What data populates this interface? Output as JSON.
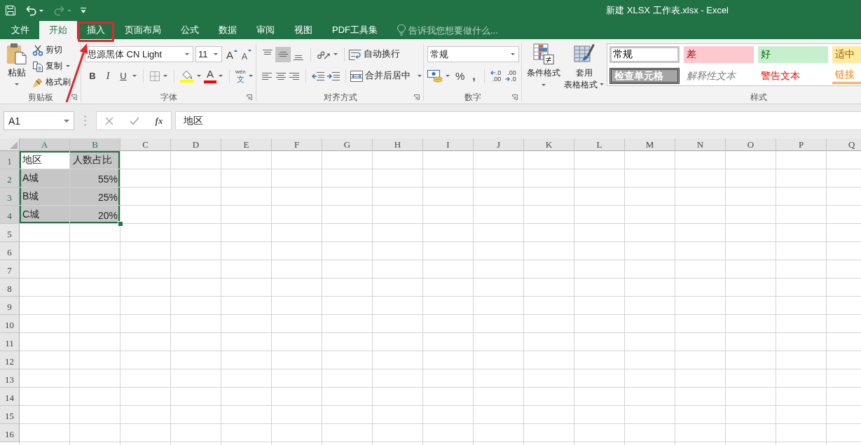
{
  "window": {
    "title": "新建 XLSX 工作表.xlsx - Excel"
  },
  "quick_access": [
    {
      "kind": "save",
      "disabled": false,
      "menu": false
    },
    {
      "kind": "undo",
      "disabled": false,
      "menu": true
    },
    {
      "kind": "redo",
      "disabled": true,
      "menu": true
    },
    {
      "kind": "customize",
      "disabled": false,
      "menu": false
    }
  ],
  "tabs": [
    {
      "label": "文件",
      "selected": false,
      "highlighted": false
    },
    {
      "label": "开始",
      "selected": true,
      "highlighted": false
    },
    {
      "label": "插入",
      "selected": false,
      "highlighted": true
    },
    {
      "label": "页面布局",
      "selected": false,
      "highlighted": false
    },
    {
      "label": "公式",
      "selected": false,
      "highlighted": false
    },
    {
      "label": "数据",
      "selected": false,
      "highlighted": false
    },
    {
      "label": "审阅",
      "selected": false,
      "highlighted": false
    },
    {
      "label": "视图",
      "selected": false,
      "highlighted": false
    },
    {
      "label": "PDF工具集",
      "selected": false,
      "highlighted": false
    }
  ],
  "tell_me": {
    "placeholder": "告诉我您想要做什么..."
  },
  "ribbon": {
    "clipboard": {
      "label": "剪贴板",
      "paste": "粘贴",
      "commands": [
        {
          "kind": "cut",
          "label": "剪切",
          "menu": false
        },
        {
          "kind": "copy",
          "label": "复制",
          "menu": true
        },
        {
          "kind": "format-painter",
          "label": "格式刷",
          "menu": false
        }
      ]
    },
    "font": {
      "label": "字体",
      "font_name": "思源黑体 CN Light",
      "font_size": "11",
      "grow": "A",
      "shrink": "A",
      "styles": [
        {
          "kind": "bold",
          "label": "B",
          "menu": false
        },
        {
          "kind": "italic",
          "label": "I",
          "menu": false
        },
        {
          "kind": "underline",
          "label": "U",
          "menu": true
        }
      ],
      "font_color": "A",
      "phonetic": {
        "ruby": "wén",
        "base": "文"
      }
    },
    "alignment": {
      "label": "对齐方式",
      "vertical": [
        {
          "kind": "top",
          "selected": false
        },
        {
          "kind": "middle",
          "selected": true
        },
        {
          "kind": "bottom",
          "selected": false
        }
      ],
      "horizontal": [
        {
          "kind": "left",
          "selected": false
        },
        {
          "kind": "center",
          "selected": false
        },
        {
          "kind": "right",
          "selected": false
        }
      ],
      "wrap_text": "自动换行",
      "merge": "合并后居中"
    },
    "number": {
      "label": "数字",
      "format": "常规",
      "percent": "%",
      "comma": ",",
      "decimals": [
        {
          "kind": "increase",
          "top": ".0",
          "bottom": ".00"
        },
        {
          "kind": "decrease",
          "top": ".00",
          "bottom": ".0"
        }
      ]
    },
    "styles": {
      "label": "样式",
      "conditional": "条件格式",
      "table_format": [
        "套用",
        "表格格式"
      ],
      "cell_styles": [
        {
          "kind": "normal",
          "label": "常规",
          "selected": true
        },
        {
          "kind": "bad",
          "label": "差",
          "selected": false
        },
        {
          "kind": "good",
          "label": "好",
          "selected": false
        },
        {
          "kind": "neutral",
          "label": "适中",
          "selected": false
        },
        {
          "kind": "check",
          "label": "检查单元格",
          "selected": false
        },
        {
          "kind": "explanatory",
          "label": "解释性文本",
          "selected": false
        },
        {
          "kind": "warning",
          "label": "警告文本",
          "selected": false
        },
        {
          "kind": "linked",
          "label": "链接",
          "selected": false
        }
      ]
    }
  },
  "formula_bar": {
    "name_box": "A1",
    "function_label": "fx",
    "formula": "地区"
  },
  "sheet": {
    "columns": [
      {
        "label": "A",
        "selected": true
      },
      {
        "label": "B",
        "selected": true
      },
      {
        "label": "C",
        "selected": false
      },
      {
        "label": "D",
        "selected": false
      },
      {
        "label": "E",
        "selected": false
      },
      {
        "label": "F",
        "selected": false
      },
      {
        "label": "G",
        "selected": false
      },
      {
        "label": "H",
        "selected": false
      },
      {
        "label": "I",
        "selected": false
      },
      {
        "label": "J",
        "selected": false
      },
      {
        "label": "K",
        "selected": false
      },
      {
        "label": "L",
        "selected": false
      },
      {
        "label": "M",
        "selected": false
      },
      {
        "label": "N",
        "selected": false
      },
      {
        "label": "O",
        "selected": false
      },
      {
        "label": "P",
        "selected": false
      },
      {
        "label": "Q",
        "selected": false
      }
    ],
    "rows": [
      {
        "label": "1",
        "selected": true,
        "cells": [
          {
            "kind": "text",
            "text": "地区",
            "selected": true,
            "active": true
          },
          {
            "kind": "text",
            "text": "人数占比",
            "selected": true,
            "active": false
          }
        ]
      },
      {
        "label": "2",
        "selected": true,
        "cells": [
          {
            "kind": "text",
            "text": "A城",
            "selected": true,
            "active": false
          },
          {
            "kind": "number",
            "text": "55%",
            "selected": true,
            "active": false
          }
        ]
      },
      {
        "label": "3",
        "selected": true,
        "cells": [
          {
            "kind": "text",
            "text": "B城",
            "selected": true,
            "active": false
          },
          {
            "kind": "number",
            "text": "25%",
            "selected": true,
            "active": false
          }
        ]
      },
      {
        "label": "4",
        "selected": true,
        "cells": [
          {
            "kind": "text",
            "text": "C城",
            "selected": true,
            "active": false
          },
          {
            "kind": "number",
            "text": "20%",
            "selected": true,
            "active": false
          }
        ]
      },
      {
        "label": "5",
        "selected": false
      },
      {
        "label": "6",
        "selected": false
      },
      {
        "label": "7",
        "selected": false
      },
      {
        "label": "8",
        "selected": false
      },
      {
        "label": "9",
        "selected": false
      },
      {
        "label": "10",
        "selected": false
      },
      {
        "label": "11",
        "selected": false
      },
      {
        "label": "12",
        "selected": false
      },
      {
        "label": "13",
        "selected": false
      },
      {
        "label": "14",
        "selected": false
      },
      {
        "label": "15",
        "selected": false
      },
      {
        "label": "16",
        "selected": false
      }
    ]
  },
  "annotations": [
    {
      "kind": "arrow"
    }
  ]
}
